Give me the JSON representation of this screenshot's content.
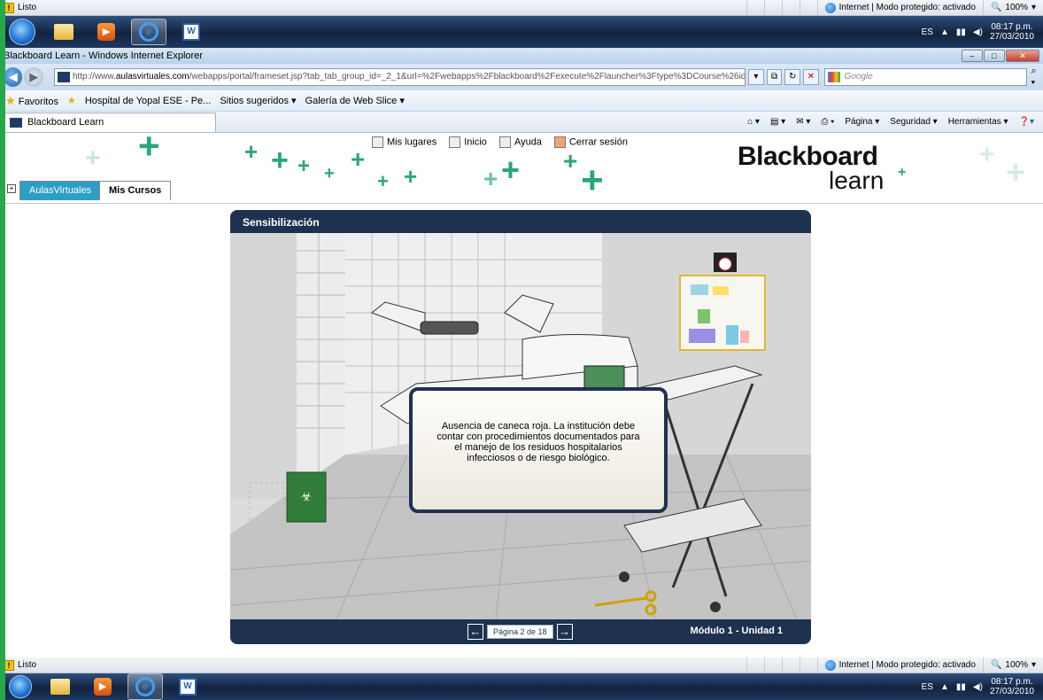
{
  "status": {
    "text": "Listo",
    "zone": "Internet | Modo protegido: activado",
    "zoom": "100%"
  },
  "taskbar": {
    "lang": "ES",
    "time": "08:17 p.m.",
    "date": "27/03/2010"
  },
  "window": {
    "title": "Blackboard Learn - Windows Internet Explorer"
  },
  "address": {
    "url_pre": "http://www.",
    "url_domain": "aulasvirtuales.com",
    "url_rest": "/webapps/portal/frameset.jsp?tab_tab_group_id=_2_1&url=%2Fwebapps%2Fblackboard%2Fexecute%2Flauncher%3Ftype%3DCourse%26id%3D_1(",
    "search_placeholder": "Google"
  },
  "favorites": {
    "label": "Favoritos",
    "items": [
      "Hospital de Yopal ESE - Pe...",
      "Sitios sugeridos ▾",
      "Galería de Web Slice ▾"
    ]
  },
  "tab": {
    "label": "Blackboard Learn"
  },
  "commands": [
    "Página ▾",
    "Seguridad ▾",
    "Herramientas ▾"
  ],
  "bb": {
    "links": [
      "Mis lugares",
      "Inicio",
      "Ayuda",
      "Cerrar sesión"
    ],
    "logo_top": "Blackboard",
    "logo_bottom": "learn",
    "tabs": [
      "AulasVirtuales",
      "Mis Cursos"
    ]
  },
  "module": {
    "title": "Sensibilización",
    "note": "Ausencia de caneca roja. La institución debe contar  con procedimientos documentados para el manejo de los residuos hospitalarios infecciosos o de riesgo biológico.",
    "page": "Página 2 de 18",
    "label": "Módulo 1 - Unidad 1"
  }
}
